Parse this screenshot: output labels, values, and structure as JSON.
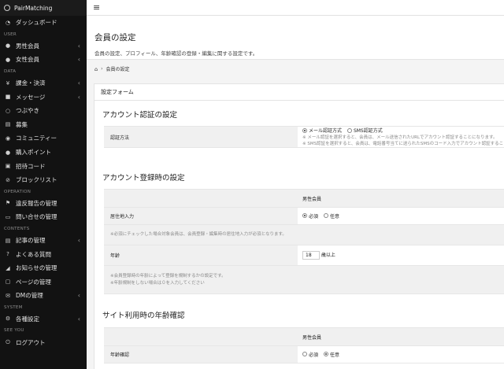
{
  "brand": "PairMatching",
  "topbar": {
    "menu_icon": "hamburger-icon"
  },
  "sidebar": {
    "items": [
      {
        "type": "item",
        "icon": "speedometer-icon",
        "label": "ダッシュボード",
        "chev": false
      },
      {
        "type": "head",
        "label": "USER"
      },
      {
        "type": "item",
        "icon": "user-icon",
        "label": "男性会員",
        "chev": true
      },
      {
        "type": "item",
        "icon": "user-icon",
        "label": "女性会員",
        "chev": true
      },
      {
        "type": "head",
        "label": "DATA"
      },
      {
        "type": "item",
        "icon": "yen-icon",
        "label": "課金・決済",
        "chev": true
      },
      {
        "type": "item",
        "icon": "chat-icon",
        "label": "メッセージ",
        "chev": true
      },
      {
        "type": "item",
        "icon": "bubble-icon",
        "label": "つぶやき",
        "chev": false
      },
      {
        "type": "item",
        "icon": "clipboard-icon",
        "label": "募集",
        "chev": false
      },
      {
        "type": "item",
        "icon": "group-icon",
        "label": "コミュニティー",
        "chev": false
      },
      {
        "type": "item",
        "icon": "coin-icon",
        "label": "購入ポイント",
        "chev": false
      },
      {
        "type": "item",
        "icon": "doc-icon",
        "label": "招待コード",
        "chev": false
      },
      {
        "type": "item",
        "icon": "ban-icon",
        "label": "ブロックリスト",
        "chev": false
      },
      {
        "type": "head",
        "label": "OPERATION"
      },
      {
        "type": "item",
        "icon": "flag-icon",
        "label": "違反報告の管理",
        "chev": false
      },
      {
        "type": "item",
        "icon": "inbox-icon",
        "label": "問い合せの管理",
        "chev": false
      },
      {
        "type": "head",
        "label": "CONTENTS"
      },
      {
        "type": "item",
        "icon": "file-icon",
        "label": "記事の管理",
        "chev": true
      },
      {
        "type": "item",
        "icon": "question-icon",
        "label": "よくある質問",
        "chev": false
      },
      {
        "type": "item",
        "icon": "megaphone-icon",
        "label": "お知らせの管理",
        "chev": false
      },
      {
        "type": "item",
        "icon": "page-icon",
        "label": "ページの管理",
        "chev": false
      },
      {
        "type": "item",
        "icon": "mail-icon",
        "label": "DMの管理",
        "chev": true
      },
      {
        "type": "head",
        "label": "SYSTEM"
      },
      {
        "type": "item",
        "icon": "gear-icon",
        "label": "各種設定",
        "chev": true
      },
      {
        "type": "head",
        "label": "SEE YOU"
      },
      {
        "type": "item",
        "icon": "power-icon",
        "label": "ログアウト",
        "chev": false
      }
    ]
  },
  "header": {
    "title": "会員の設定",
    "description": "会員の設定、プロフィール、年齢確認の登録・編集に関する設定です。"
  },
  "breadcrumb": {
    "home_icon": "home-icon",
    "current": "会員の設定"
  },
  "form": {
    "title": "設定フォーム",
    "section1": {
      "title": "アカウント認証の設定",
      "row_label": "認証方法",
      "options": [
        "メール認証方式",
        "SMS認証方式"
      ],
      "selected": 0,
      "hint1": "※ メール認証を選択すると、会員は、メール送信されたURLでアカウント認証することになります。",
      "hint2": "※ SMS認証を選択すると、会員は、電話番号当てに送られたSMSのコード入力でアカウント認証することになります。"
    },
    "section2": {
      "title": "アカウント登録時の設定",
      "col_header": "男性会員",
      "residence_label": "居住地入力",
      "residence_options": [
        "必須",
        "任意"
      ],
      "residence_selected": 0,
      "residence_note": "※必須にチェックした場合対象会員は、会員登録・編集時の居住地入力が必須となります。",
      "age_label": "年齢",
      "age_value": "18",
      "age_suffix": "歳以上",
      "age_note1": "※会員登録時の年齢によって登録を規制するかの設定です。",
      "age_note2": "※年齢規制をしない場合は０を入力してください"
    },
    "section3": {
      "title": "サイト利用時の年齢確認",
      "col_header": "男性会員",
      "row_label": "年齢確認",
      "options": [
        "必須",
        "任意"
      ],
      "selected": 1
    }
  }
}
